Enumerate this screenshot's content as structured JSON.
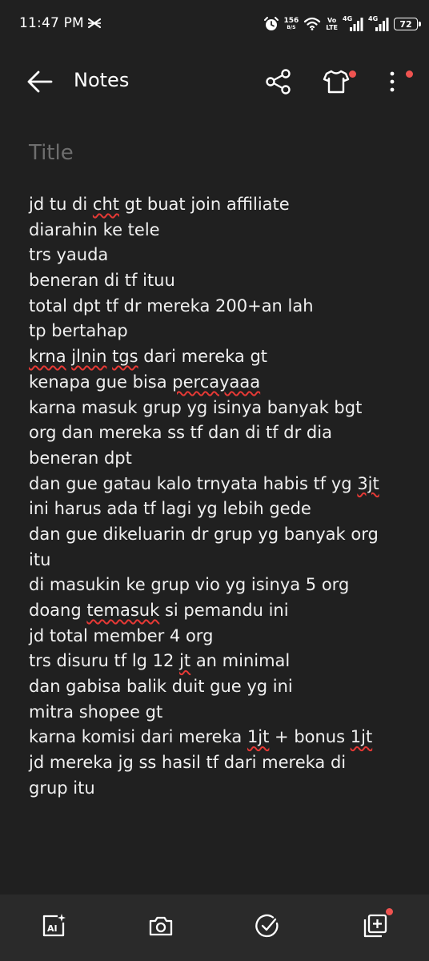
{
  "status_bar": {
    "time": "11:47 PM",
    "net_speed_value": "156",
    "net_speed_unit": "B/S",
    "volte_top": "Vo",
    "volte_bottom": "LTE",
    "sim1_label": "4G",
    "sim2_label": "4G",
    "battery": "72"
  },
  "app_bar": {
    "title": "Notes"
  },
  "note": {
    "title_placeholder": "Title",
    "lines": [
      [
        {
          "t": "jd tu di "
        },
        {
          "t": "cht",
          "s": true
        },
        {
          "t": " gt buat join affiliate"
        }
      ],
      [
        {
          "t": "diarahin ke tele"
        }
      ],
      [
        {
          "t": "trs yauda"
        }
      ],
      [
        {
          "t": "beneran di tf ituu"
        }
      ],
      [
        {
          "t": "total dpt tf dr mereka 200+an lah"
        }
      ],
      [
        {
          "t": "tp bertahap"
        }
      ],
      [
        {
          "t": "krna",
          "s": true
        },
        {
          "t": " "
        },
        {
          "t": "jlnin",
          "s": true
        },
        {
          "t": " "
        },
        {
          "t": "tgs",
          "s": true
        },
        {
          "t": " dari mereka gt"
        }
      ],
      [
        {
          "t": "kenapa gue bisa "
        },
        {
          "t": "percayaaa",
          "s": true
        }
      ],
      [
        {
          "t": "karna masuk grup yg isinya banyak bgt"
        }
      ],
      [
        {
          "t": "org dan mereka ss tf dan di tf dr dia"
        }
      ],
      [
        {
          "t": "beneran dpt"
        }
      ],
      [
        {
          "t": "dan gue gatau kalo trnyata habis tf yg "
        },
        {
          "t": "3jt",
          "s": true
        }
      ],
      [
        {
          "t": "ini harus ada tf lagi yg lebih gede"
        }
      ],
      [
        {
          "t": "dan gue dikeluarin dr grup yg banyak org"
        }
      ],
      [
        {
          "t": "itu"
        }
      ],
      [
        {
          "t": "di masukin ke grup vio yg isinya 5 org"
        }
      ],
      [
        {
          "t": "doang "
        },
        {
          "t": "temasuk",
          "s": true
        },
        {
          "t": " si pemandu ini"
        }
      ],
      [
        {
          "t": "jd total member 4 org"
        }
      ],
      [
        {
          "t": "trs disuru tf lg 12 "
        },
        {
          "t": "jt",
          "s": true
        },
        {
          "t": " an minimal"
        }
      ],
      [
        {
          "t": "dan gabisa balik duit gue yg ini"
        }
      ],
      [
        {
          "t": "mitra shopee gt"
        }
      ],
      [
        {
          "t": "karna komisi dari mereka "
        },
        {
          "t": "1jt",
          "s": true
        },
        {
          "t": " + bonus "
        },
        {
          "t": "1jt",
          "s": true
        }
      ],
      [
        {
          "t": "jd mereka jg ss hasil tf dari mereka di"
        }
      ],
      [
        {
          "t": "grup itu"
        }
      ]
    ]
  },
  "toolbar": {
    "ai_icon_text": "AI"
  },
  "icons": {
    "back": "arrow-left-icon",
    "share": "share-icon",
    "theme": "tshirt-icon",
    "more": "more-vertical-icon",
    "ai": "ai-assist-icon",
    "camera": "camera-icon",
    "checklist": "check-circle-icon",
    "add_note": "add-note-icon"
  },
  "colors": {
    "background": "#202020",
    "toolbar": "#2a2a2a",
    "text": "#f0f0f0",
    "title_placeholder": "#6e6e6e",
    "notification_dot": "#ef5350",
    "spell_underline": "#e53935"
  }
}
